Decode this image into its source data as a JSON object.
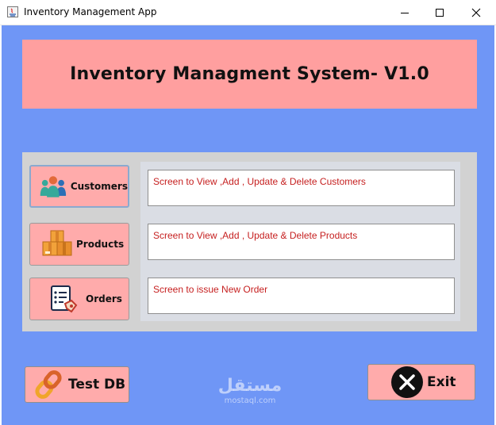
{
  "window": {
    "title": "Inventory Management App",
    "minimize_icon": "minimize-icon",
    "maximize_icon": "maximize-icon",
    "close_icon": "close-icon"
  },
  "header": {
    "title": "Inventory Managment System- V1.0"
  },
  "nav": {
    "items": [
      {
        "label": "Customers",
        "icon": "customers-icon",
        "description": "Screen to View ,Add , Update & Delete Customers"
      },
      {
        "label": "Products",
        "icon": "products-icon",
        "description": "Screen to View ,Add , Update & Delete Products"
      },
      {
        "label": "Orders",
        "icon": "orders-icon",
        "description": "Screen to  issue New Order"
      }
    ]
  },
  "actions": {
    "test_db_label": "Test DB",
    "test_db_icon": "chain-link-icon",
    "exit_label": "Exit",
    "exit_icon": "exit-icon"
  },
  "watermark": {
    "arabic": "مستقل",
    "domain": "mostaql.com"
  },
  "colors": {
    "background": "#6f96f6",
    "header_panel": "#ff9f9f",
    "button": "#ffabab",
    "description_text": "#c62020"
  }
}
